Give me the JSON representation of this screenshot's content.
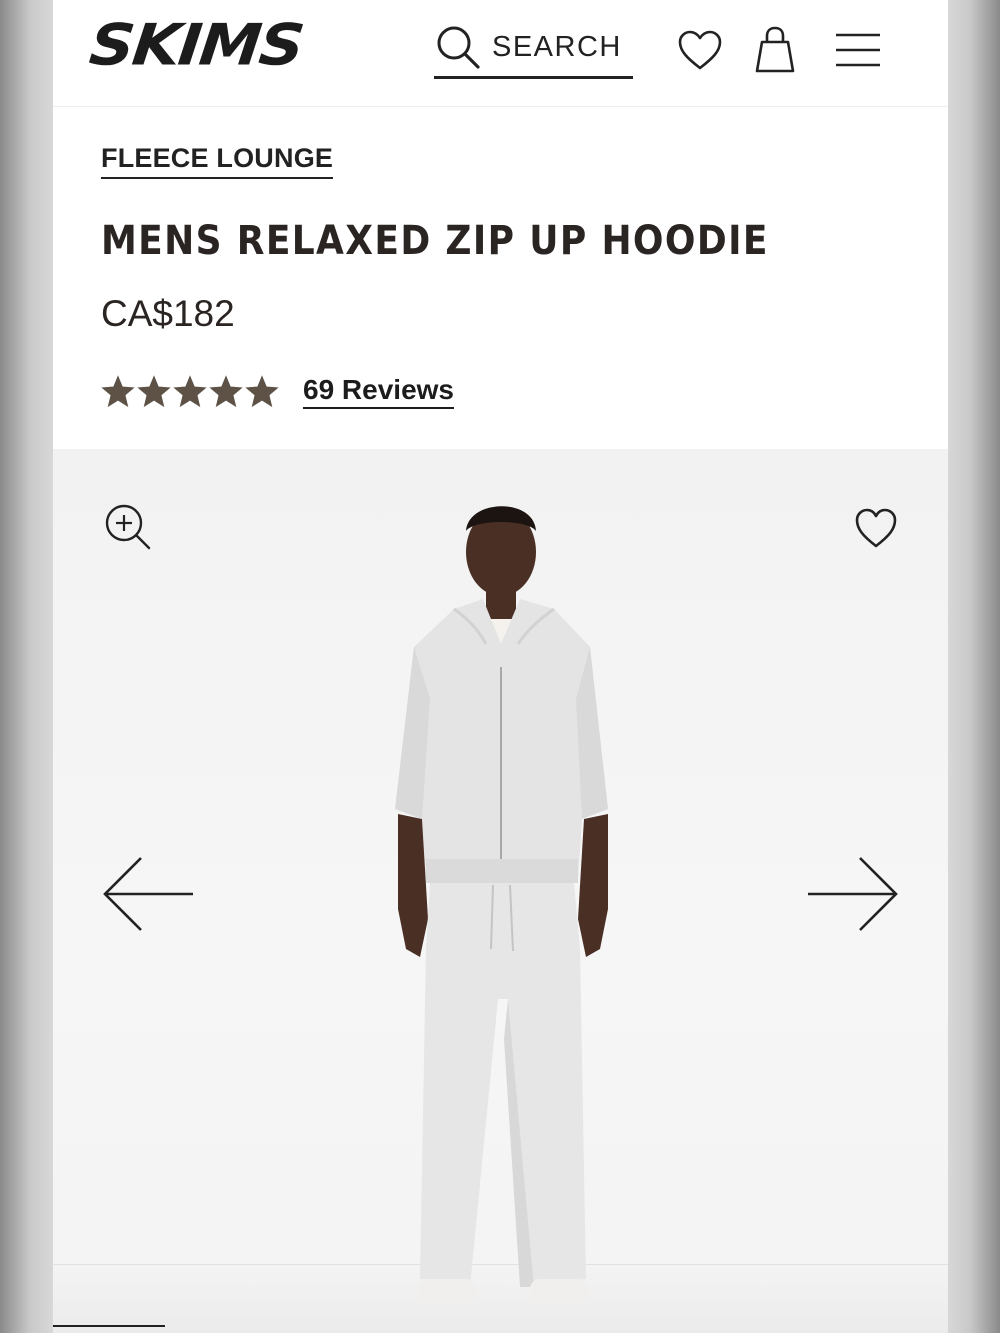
{
  "header": {
    "logo": "SKIMS",
    "search_label": "SEARCH",
    "icons": [
      "search-icon",
      "heart-icon",
      "bag-icon",
      "menu-icon"
    ]
  },
  "product": {
    "breadcrumb": "FLEECE LOUNGE",
    "title": "MENS RELAXED ZIP UP HOODIE",
    "price": "CA$182",
    "rating": 5,
    "rating_max": 5,
    "reviews_label": "69 Reviews"
  },
  "gallery": {
    "icons": [
      "zoom-in-icon",
      "wishlist-heart-icon",
      "arrow-left-icon",
      "arrow-right-icon"
    ]
  },
  "colors": {
    "text": "#222222",
    "star": "#5e5247",
    "background": "#ffffff",
    "gallery_bg": "#f3f3f3"
  }
}
